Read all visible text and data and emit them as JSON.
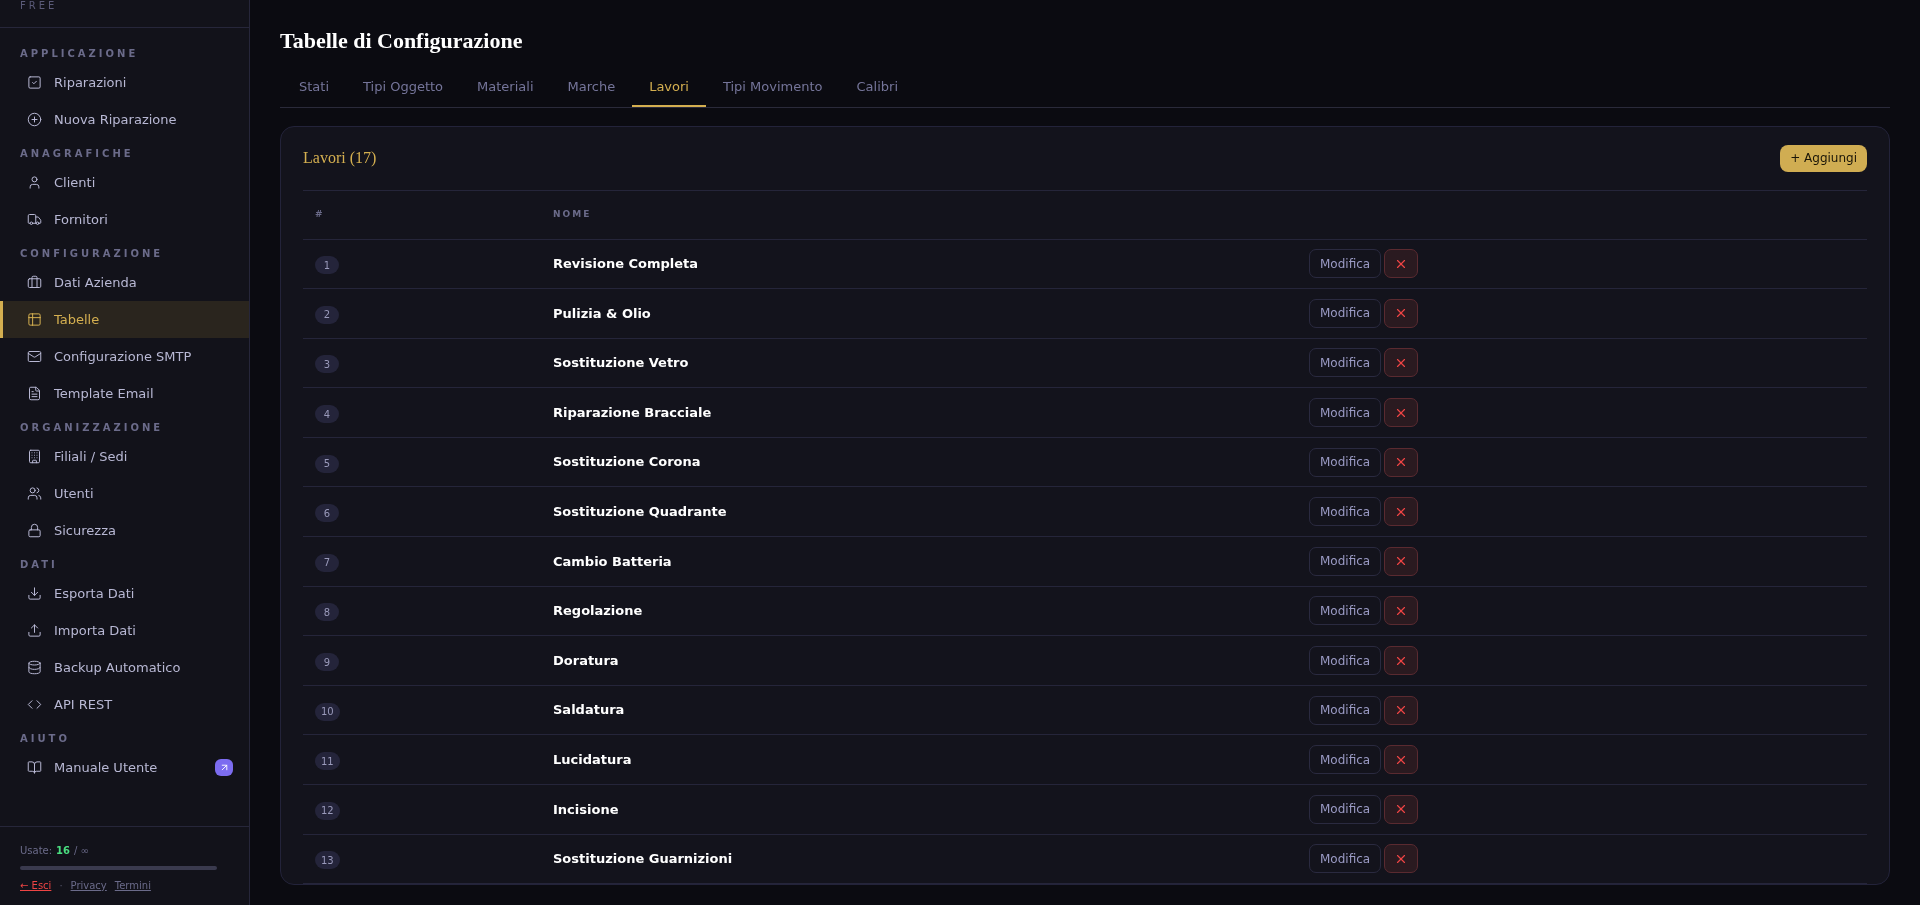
{
  "sidebar": {
    "plan": "FREE",
    "sections": [
      {
        "title": "APPLICAZIONE",
        "items": [
          {
            "label": "Riparazioni",
            "selected": false,
            "external": false
          },
          {
            "label": "Nuova Riparazione",
            "selected": false,
            "external": false
          }
        ]
      },
      {
        "title": "ANAGRAFICHE",
        "items": [
          {
            "label": "Clienti",
            "selected": false,
            "external": false
          },
          {
            "label": "Fornitori",
            "selected": false,
            "external": false
          }
        ]
      },
      {
        "title": "CONFIGURAZIONE",
        "items": [
          {
            "label": "Dati Azienda",
            "selected": false,
            "external": false
          },
          {
            "label": "Tabelle",
            "selected": true,
            "external": false
          },
          {
            "label": "Configurazione SMTP",
            "selected": false,
            "external": false
          },
          {
            "label": "Template Email",
            "selected": false,
            "external": false
          }
        ]
      },
      {
        "title": "ORGANIZZAZIONE",
        "items": [
          {
            "label": "Filiali / Sedi",
            "selected": false,
            "external": false
          },
          {
            "label": "Utenti",
            "selected": false,
            "external": false
          },
          {
            "label": "Sicurezza",
            "selected": false,
            "external": false
          }
        ]
      },
      {
        "title": "DATI",
        "items": [
          {
            "label": "Esporta Dati",
            "selected": false,
            "external": false
          },
          {
            "label": "Importa Dati",
            "selected": false,
            "external": false
          },
          {
            "label": "Backup Automatico",
            "selected": false,
            "external": false
          },
          {
            "label": "API REST",
            "selected": false,
            "external": false
          }
        ]
      },
      {
        "title": "AIUTO",
        "items": [
          {
            "label": "Manuale Utente",
            "selected": false,
            "external": true
          }
        ]
      }
    ],
    "usage": {
      "label": "Usate:",
      "value": "16",
      "limit": "/ ∞"
    },
    "logout": "← Esci",
    "separator": "·",
    "links": [
      "Privacy",
      "Termini"
    ]
  },
  "page": {
    "title": "Tabelle di Configurazione"
  },
  "tabs": [
    {
      "label": "Stati",
      "selected": false
    },
    {
      "label": "Tipi Oggetto",
      "selected": false
    },
    {
      "label": "Materiali",
      "selected": false
    },
    {
      "label": "Marche",
      "selected": false
    },
    {
      "label": "Lavori",
      "selected": true
    },
    {
      "label": "Tipi Movimento",
      "selected": false
    },
    {
      "label": "Calibri",
      "selected": false
    }
  ],
  "card": {
    "title": "Lavori (17)",
    "add_button": "+ Aggiungi",
    "columns": [
      "#",
      "NOME"
    ],
    "rows": [
      {
        "index": "1",
        "name": "Revisione Completa",
        "edit": "Modifica"
      },
      {
        "index": "2",
        "name": "Pulizia & Olio",
        "edit": "Modifica"
      },
      {
        "index": "3",
        "name": "Sostituzione Vetro",
        "edit": "Modifica"
      },
      {
        "index": "4",
        "name": "Riparazione Bracciale",
        "edit": "Modifica"
      },
      {
        "index": "5",
        "name": "Sostituzione Corona",
        "edit": "Modifica"
      },
      {
        "index": "6",
        "name": "Sostituzione Quadrante",
        "edit": "Modifica"
      },
      {
        "index": "7",
        "name": "Cambio Batteria",
        "edit": "Modifica"
      },
      {
        "index": "8",
        "name": "Regolazione",
        "edit": "Modifica"
      },
      {
        "index": "9",
        "name": "Doratura",
        "edit": "Modifica"
      },
      {
        "index": "10",
        "name": "Saldatura",
        "edit": "Modifica"
      },
      {
        "index": "11",
        "name": "Lucidatura",
        "edit": "Modifica"
      },
      {
        "index": "12",
        "name": "Incisione",
        "edit": "Modifica"
      },
      {
        "index": "13",
        "name": "Sostituzione Guarnizioni",
        "edit": "Modifica"
      }
    ]
  }
}
